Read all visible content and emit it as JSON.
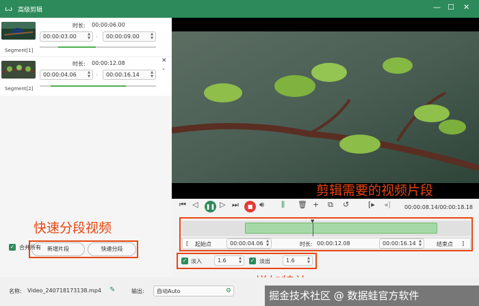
{
  "window": {
    "title": "高级剪辑",
    "logo": "ꙍ",
    "min": "—",
    "max": "☐",
    "close": "✕"
  },
  "segments": [
    {
      "label": "Segment[1]",
      "duration_label": "时长:",
      "duration": "00:00:06.00",
      "start": "00:00:03.00",
      "end": "00:00:09.00"
    },
    {
      "label": "Segment[2]",
      "duration_label": "时长:",
      "duration": "00:00:12.08",
      "start": "00:00:04.06",
      "end": "00:00:16.14"
    }
  ],
  "left_actions": {
    "add_segment": "新增片段",
    "quick_split": "快速分段",
    "merge_all": "合并所有"
  },
  "player": {
    "time_display": "00:00:08.14/00:00:18.18",
    "cut_start_label": "起始点",
    "cut_start": "00:00:04.06",
    "cut_duration_label": "时长:",
    "cut_duration": "00:00:12.08",
    "cut_end": "00:00:16.14",
    "cut_end_label": "结束点"
  },
  "effects": {
    "fade_in_label": "淡入",
    "fade_in_value": "1.6",
    "fade_out_label": "淡出",
    "fade_out_value": "1.6"
  },
  "bottom": {
    "name_label": "名称:",
    "file_name": "Video_240718173138.mp4",
    "output_label": "输出:",
    "output_value": "自动Auto"
  },
  "annotations": {
    "quick_split": "快速分段视频",
    "cut_needed": "剪辑需要的视频片段",
    "effects": "增加特效"
  },
  "watermark": "掘金技术社区 @ 数据蛙官方软件",
  "colors": {
    "accent": "#2d8a5a",
    "annotation": "#e8450f",
    "selection": "#a7d9a8"
  }
}
